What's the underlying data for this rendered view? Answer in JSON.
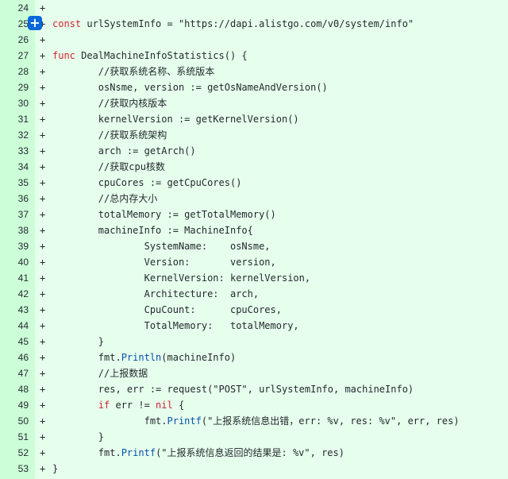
{
  "diff": {
    "add_button_symbol": "+",
    "marker": "+",
    "lines": [
      {
        "n": "24",
        "t": ""
      },
      {
        "n": "25",
        "t": "const urlSystemInfo = \"https://dapi.alistgo.com/v0/system/info\""
      },
      {
        "n": "26",
        "t": ""
      },
      {
        "n": "27",
        "t": "func DealMachineInfoStatistics() {"
      },
      {
        "n": "28",
        "t": "        //获取系统名称、系统版本"
      },
      {
        "n": "29",
        "t": "        osNsme, version := getOsNameAndVersion()"
      },
      {
        "n": "30",
        "t": "        //获取内核版本"
      },
      {
        "n": "31",
        "t": "        kernelVersion := getKernelVersion()"
      },
      {
        "n": "32",
        "t": "        //获取系统架构"
      },
      {
        "n": "33",
        "t": "        arch := getArch()"
      },
      {
        "n": "34",
        "t": "        //获取cpu核数"
      },
      {
        "n": "35",
        "t": "        cpuCores := getCpuCores()"
      },
      {
        "n": "36",
        "t": "        //总内存大小"
      },
      {
        "n": "37",
        "t": "        totalMemory := getTotalMemory()"
      },
      {
        "n": "38",
        "t": "        machineInfo := MachineInfo{"
      },
      {
        "n": "39",
        "t": "                SystemName:    osNsme,"
      },
      {
        "n": "40",
        "t": "                Version:       version,"
      },
      {
        "n": "41",
        "t": "                KernelVersion: kernelVersion,"
      },
      {
        "n": "42",
        "t": "                Architecture:  arch,"
      },
      {
        "n": "43",
        "t": "                CpuCount:      cpuCores,"
      },
      {
        "n": "44",
        "t": "                TotalMemory:   totalMemory,"
      },
      {
        "n": "45",
        "t": "        }"
      },
      {
        "n": "46",
        "t": "        fmt.Println(machineInfo)"
      },
      {
        "n": "47",
        "t": "        //上报数据"
      },
      {
        "n": "48",
        "t": "        res, err := request(\"POST\", urlSystemInfo, machineInfo)"
      },
      {
        "n": "49",
        "t": "        if err != nil {"
      },
      {
        "n": "50",
        "t": "                fmt.Printf(\"上报系统信息出错，err: %v, res: %v\", err, res)"
      },
      {
        "n": "51",
        "t": "        }"
      },
      {
        "n": "52",
        "t": "        fmt.Printf(\"上报系统信息返回的结果是: %v\", res)"
      },
      {
        "n": "53",
        "t": "}"
      }
    ]
  },
  "colors": {
    "added_line_bg": "#e6ffec",
    "added_gutter_bg": "#ccffd8",
    "keyword": "#cf222e",
    "function": "#0550ae",
    "add_button": "#0969da"
  }
}
